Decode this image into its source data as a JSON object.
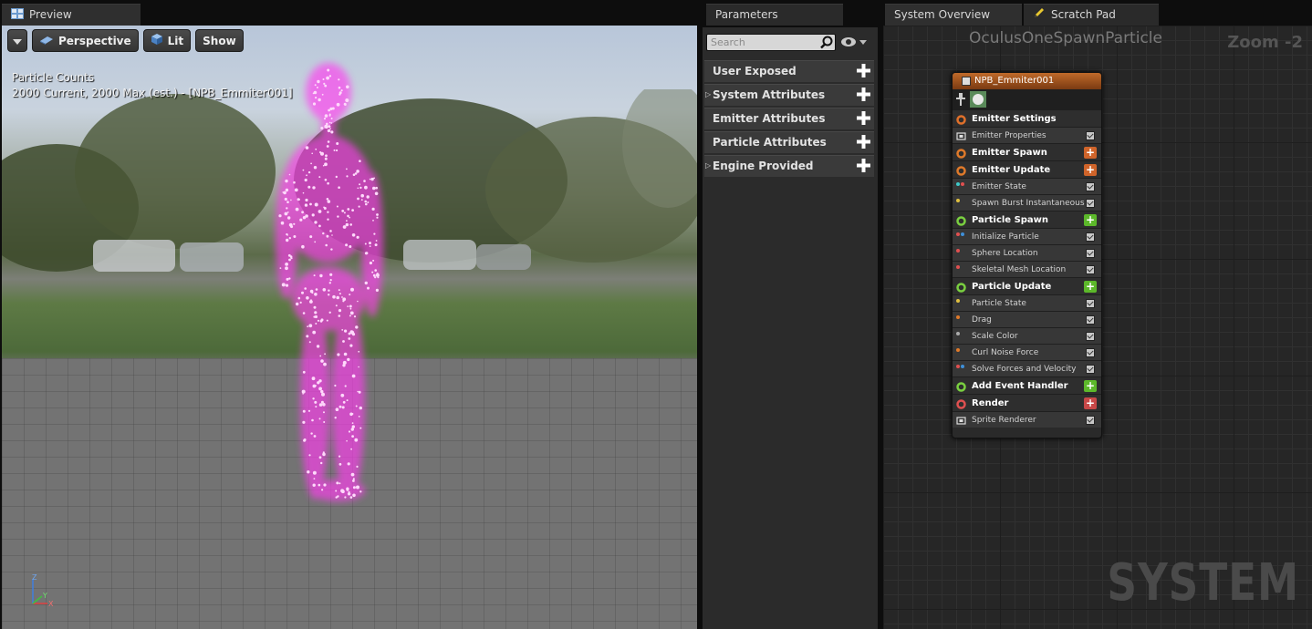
{
  "tabs": {
    "preview": "Preview",
    "parameters": "Parameters",
    "system_overview": "System Overview",
    "scratch_pad": "Scratch Pad"
  },
  "viewport": {
    "perspective_label": "Perspective",
    "lit_label": "Lit",
    "show_label": "Show",
    "particle_counts_title": "Particle Counts",
    "particle_counts_line": "2000 Current, 2000 Max (est.) - [NPB_Emmiter001]",
    "axis": {
      "x": "X",
      "y": "Y",
      "z": "Z"
    }
  },
  "parameters": {
    "search_placeholder": "Search",
    "rows": [
      {
        "label": "User Exposed"
      },
      {
        "label": "System Attributes"
      },
      {
        "label": "Emitter Attributes"
      },
      {
        "label": "Particle Attributes"
      },
      {
        "label": "Engine Provided"
      }
    ]
  },
  "system": {
    "title": "OculusOneSpawnParticle",
    "zoom": "Zoom -2",
    "watermark": "SYSTEM"
  },
  "node": {
    "title": "NPB_Emmiter001",
    "rows": [
      {
        "label": "Emitter Settings",
        "header": true,
        "icon_color": "#e0702a"
      },
      {
        "label": "Emitter Properties",
        "icon": "cpu-icon"
      },
      {
        "label": "Emitter Spawn",
        "header": true,
        "icon_color": "#e07a2a",
        "add_color": "#d0642a"
      },
      {
        "label": "Emitter Update",
        "header": true,
        "icon_color": "#e07a2a",
        "add_color": "#d0642a"
      },
      {
        "label": "Emitter State",
        "dots": [
          "#3fc8c8",
          "#e05050"
        ]
      },
      {
        "label": "Spawn Burst Instantaneous",
        "dots": [
          "#e0c040"
        ]
      },
      {
        "label": "Particle Spawn",
        "header": true,
        "icon_color": "#7ad040",
        "add_color": "#5cb82a"
      },
      {
        "label": "Initialize Particle",
        "dots": [
          "#e05050",
          "#3f8fd8"
        ]
      },
      {
        "label": "Sphere Location",
        "dots": [
          "#e05050"
        ]
      },
      {
        "label": "Skeletal Mesh Location",
        "dots": [
          "#e05050"
        ]
      },
      {
        "label": "Particle Update",
        "header": true,
        "icon_color": "#7ad040",
        "add_color": "#5cb82a"
      },
      {
        "label": "Particle State",
        "dots": [
          "#e0c040"
        ]
      },
      {
        "label": "Drag",
        "dots": [
          "#e07a2a"
        ]
      },
      {
        "label": "Scale Color",
        "dots": [
          "#aaaaaa"
        ]
      },
      {
        "label": "Curl Noise Force",
        "dots": [
          "#e07a2a"
        ]
      },
      {
        "label": "Solve Forces and Velocity",
        "dots": [
          "#e05050",
          "#3f8fd8"
        ]
      },
      {
        "label": "Add Event Handler",
        "header": true,
        "icon_color": "#7ad040",
        "add_color": "#5cb82a"
      },
      {
        "label": "Render",
        "header": true,
        "icon_color": "#e05050",
        "add_color": "#c84848"
      },
      {
        "label": "Sprite Renderer",
        "icon": "sprite-icon"
      }
    ]
  },
  "colors": {
    "particle": "#ff4cf0",
    "panel_bg": "#2b2b2b"
  }
}
